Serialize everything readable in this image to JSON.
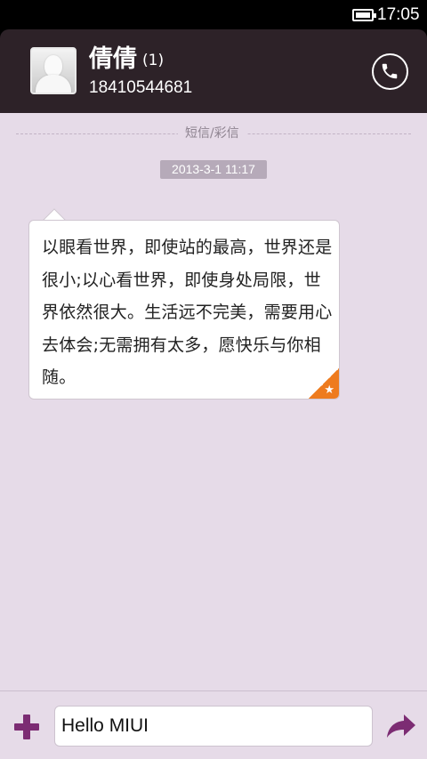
{
  "status_bar": {
    "time": "17:05",
    "battery_icon": "battery-full-icon"
  },
  "header": {
    "contact_name": "倩倩",
    "unread_count": "(1)",
    "phone_number": "18410544681",
    "avatar_icon": "person-silhouette-icon",
    "call_icon": "phone-icon"
  },
  "conversation": {
    "section_label": "短信/彩信",
    "timestamp": "2013-3-1 11:17",
    "messages": [
      {
        "text": "以眼看世界，即使站的最高，世界还是很小;以心看世界，即使身处局限，世界依然很大。生活远不完美，需要用心去体会;无需拥有太多，愿快乐与你相随。",
        "starred": true,
        "star_icon": "star-icon"
      }
    ]
  },
  "composer": {
    "input_value": "Hello MIUI",
    "add_icon": "plus-icon",
    "send_icon": "send-arrow-icon"
  },
  "colors": {
    "header_bg": "#2d2228",
    "conversation_bg": "#e6dbe8",
    "accent": "#7c2c73",
    "star_corner": "#ee7b1e",
    "timestamp_bg": "#b6aab9"
  }
}
